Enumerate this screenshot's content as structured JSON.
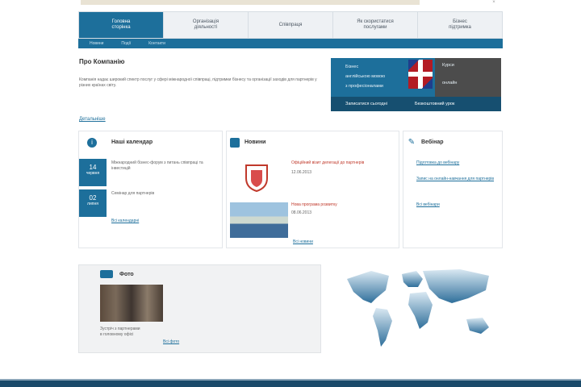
{
  "top": {
    "close_glyph": "×"
  },
  "nav": {
    "tabs": [
      {
        "line1": "Головна",
        "line2": "сторінка",
        "active": true
      },
      {
        "line1": "Організація",
        "line2": "діяльності",
        "active": false
      },
      {
        "line1": "Співпраця",
        "line2": "",
        "active": false
      },
      {
        "line1": "Як скористатися",
        "line2": "послугами",
        "active": false
      },
      {
        "line1": "Бізнес",
        "line2": "підтримка",
        "active": false
      }
    ],
    "subnav": [
      "Новини",
      "Події",
      "Контакти"
    ]
  },
  "intro": {
    "title": "Про Компанію",
    "text": "Компанія надає широкий спектр послуг у сфері міжнародної співпраці, підтримки бізнесу та організації заходів для партнерів у різних країнах світу.",
    "more_label": "Детальніше"
  },
  "promo": {
    "line1": "Бізнес",
    "line2": "англійською мовою",
    "line3": "з професіоналами",
    "right1": "Курси",
    "right2": "онлайн",
    "bar_left": "Записатися сьогодні",
    "bar_right": "Безкоштовний урок"
  },
  "events": {
    "title": "Наші календар",
    "items": [
      {
        "day": "14",
        "month": "червня",
        "text": "Міжнародний бізнес-форум з питань співпраці та інвестицій"
      },
      {
        "day": "02",
        "month": "липня",
        "text": "Семінар для партнерів"
      }
    ],
    "all_label": "Всі календарні"
  },
  "news": {
    "title": "Новини",
    "items": [
      {
        "title": "Офіційний візит делегації до партнерів",
        "date": "12.06.2013"
      },
      {
        "title": "Нова програма розвитку",
        "date": "08.06.2013"
      }
    ],
    "all_label": "Всі новини"
  },
  "links": {
    "title": "Вебінар",
    "items": [
      "Підготовка до вебінару",
      "Запис на онлайн-навчання для партнерів",
      "Всі вебінари"
    ]
  },
  "photo": {
    "title": "Фото",
    "caption1": "Зустріч з партнерами",
    "caption2": "в головному офісі",
    "more_label": "Всі фото"
  },
  "colors": {
    "primary": "#1d6f9b",
    "dark": "#164f70",
    "map": "#5a97be"
  }
}
